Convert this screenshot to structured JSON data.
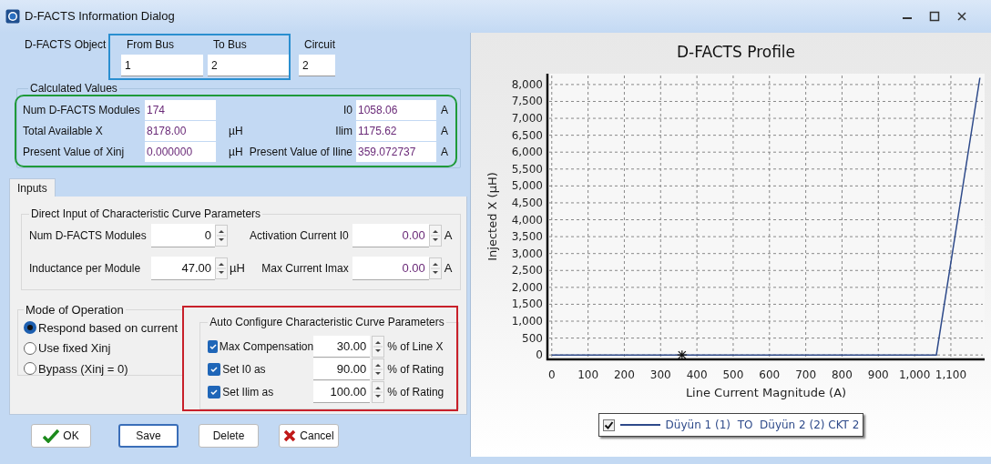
{
  "window": {
    "title": "D-FACTS Information Dialog"
  },
  "object": {
    "label": "D-FACTS Object",
    "fields": [
      {
        "label": "From Bus",
        "value": "1"
      },
      {
        "label": "To Bus",
        "value": "2"
      },
      {
        "label": "Circuit",
        "value": "2"
      }
    ]
  },
  "calculated": {
    "title": "Calculated Values",
    "left": [
      {
        "label": "Num D-FACTS Modules",
        "value": "174"
      },
      {
        "label": "Total Available X",
        "value": "8178.00",
        "unit": "µH"
      },
      {
        "label": "Present Value of Xinj",
        "value": "0.000000",
        "unit": "µH"
      }
    ],
    "right": [
      {
        "label": "I0",
        "value": "1058.06",
        "unit": "A"
      },
      {
        "label": "Ilim",
        "value": "1175.62",
        "unit": "A"
      },
      {
        "label": "Present Value of Iline",
        "value": "359.072737",
        "unit": "A"
      }
    ]
  },
  "tabs": [
    {
      "label": "Inputs",
      "selected": true
    }
  ],
  "direct": {
    "title": "Direct Input of Characteristic Curve Parameters",
    "fields": [
      {
        "label": "Num D-FACTS Modules",
        "value": "0"
      },
      {
        "label": "Activation Current I0",
        "value": "0.00",
        "unit": "A"
      },
      {
        "label": "Inductance per Module",
        "value": "47.00",
        "unit": "µH"
      },
      {
        "label": "Max Current Imax",
        "value": "0.00",
        "unit": "A"
      }
    ]
  },
  "mode": {
    "title": "Mode of Operation",
    "options": [
      {
        "label": "Respond based on current",
        "selected": true
      },
      {
        "label": "Use fixed Xinj",
        "selected": false
      },
      {
        "label": "Bypass (Xinj = 0)",
        "selected": false
      }
    ]
  },
  "auto": {
    "title": "Auto Configure Characteristic Curve Parameters",
    "rows": [
      {
        "label": "Max Compensation",
        "checked": true,
        "value": "30.00",
        "unit": "% of Line X"
      },
      {
        "label": "Set I0 as",
        "checked": true,
        "value": "90.00",
        "unit": "% of Rating"
      },
      {
        "label": "Set Ilim as",
        "checked": true,
        "value": "100.00",
        "unit": "% of Rating"
      }
    ]
  },
  "buttons": [
    {
      "label": "OK",
      "kind": "ok",
      "focused": false
    },
    {
      "label": "Save",
      "kind": "plain",
      "focused": true
    },
    {
      "label": "Delete",
      "kind": "plain",
      "focused": false
    },
    {
      "label": "Cancel",
      "kind": "cancel",
      "focused": false
    }
  ],
  "chart": {
    "legend": {
      "checked": true
    },
    "chart_data": {
      "type": "line",
      "title": "D-FACTS Profile",
      "xlabel": "Line Current Magnitude (A)",
      "ylabel": "Injected X (µH)",
      "x": [
        0,
        1060,
        1180
      ],
      "series": [
        {
          "name": "Düyün 1 (1)  TO  Düyün 2 (2) CKT 2",
          "color": "#2e4a8a",
          "values": [
            0,
            0,
            8200
          ]
        }
      ],
      "grid": true,
      "xlim": [
        -12,
        1193
      ],
      "ylim": [
        -130,
        8320
      ],
      "xticks": [
        0,
        100,
        200,
        300,
        400,
        500,
        600,
        700,
        800,
        900,
        {
          "value": 1000,
          "label": "1,000"
        },
        {
          "value": 1100,
          "label": "1,100"
        }
      ],
      "yticks": [
        0,
        500,
        {
          "value": 1000,
          "label": "1,000"
        },
        {
          "value": 1500,
          "label": "1,500"
        },
        {
          "value": 2000,
          "label": "2,000"
        },
        {
          "value": 2500,
          "label": "2,500"
        },
        {
          "value": 3000,
          "label": "3,000"
        },
        {
          "value": 3500,
          "label": "3,500"
        },
        {
          "value": 4000,
          "label": "4,000"
        },
        {
          "value": 4500,
          "label": "4,500"
        },
        {
          "value": 5000,
          "label": "5,000"
        },
        {
          "value": 5500,
          "label": "5,500"
        },
        {
          "value": 6000,
          "label": "6,000"
        },
        {
          "value": 6500,
          "label": "6,500"
        },
        {
          "value": 7000,
          "label": "7,000"
        },
        {
          "value": 7500,
          "label": "7,500"
        },
        {
          "value": 8000,
          "label": "8,000"
        }
      ]
    }
  }
}
